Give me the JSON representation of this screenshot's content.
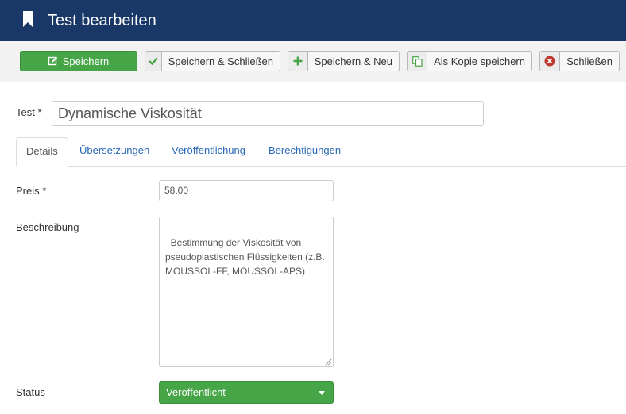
{
  "header": {
    "title": "Test bearbeiten",
    "icon": "bookmark-icon"
  },
  "toolbar": {
    "save_label": "Speichern",
    "save_close_label": "Speichern & Schließen",
    "save_new_label": "Speichern & Neu",
    "save_copy_label": "Als Kopie speichern",
    "close_label": "Schließen"
  },
  "form": {
    "title_label": "Test *",
    "title_value": "Dynamische Viskosität",
    "tabs": [
      {
        "label": "Details",
        "active": true
      },
      {
        "label": "Übersetzungen",
        "active": false
      },
      {
        "label": "Veröffentlichung",
        "active": false
      },
      {
        "label": "Berechtigungen",
        "active": false
      }
    ],
    "price_label": "Preis *",
    "price_value": "58.00",
    "description_label": "Beschreibung",
    "description_value": "Bestimmung der Viskosität von pseudoplastischen Flüssigkeiten (z.B. MOUSSOL-FF, MOUSSOL-APS)",
    "status_label": "Status",
    "status_value": "Veröffentlicht"
  },
  "colors": {
    "header_bg": "#1a3867",
    "success": "#46a546",
    "link": "#2a69b8",
    "danger": "#bd362f"
  }
}
